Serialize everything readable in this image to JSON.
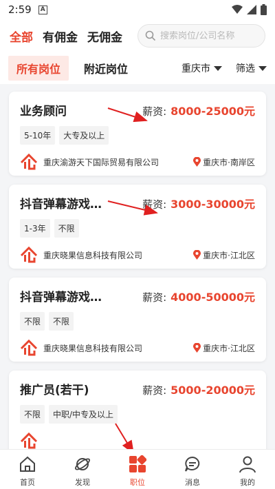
{
  "status_bar": {
    "time": "2:59"
  },
  "filter_tabs": [
    {
      "label": "全部",
      "active": true
    },
    {
      "label": "有佣金",
      "active": false
    },
    {
      "label": "无佣金",
      "active": false
    }
  ],
  "search": {
    "placeholder": "搜索岗位/公司名称"
  },
  "position_tabs": [
    {
      "label": "所有岗位",
      "active": true
    },
    {
      "label": "附近岗位",
      "active": false
    }
  ],
  "city_dropdown": "重庆市",
  "filter_dropdown": "筛选",
  "salary_label": "薪资:",
  "jobs": [
    {
      "title": "业务顾问",
      "salary": "8000-25000元",
      "tags": [
        "5-10年",
        "大专及以上"
      ],
      "company": "重庆渝游天下国际贸易有限公司",
      "location": "重庆市·南岸区"
    },
    {
      "title": "抖音弹幕游戏…",
      "salary": "3000-30000元",
      "tags": [
        "1-3年",
        "不限"
      ],
      "company": "重庆晓果信息科技有限公司",
      "location": "重庆市·江北区"
    },
    {
      "title": "抖音弹幕游戏…",
      "salary": "4000-50000元",
      "tags": [
        "不限",
        "不限"
      ],
      "company": "重庆晓果信息科技有限公司",
      "location": "重庆市·江北区"
    },
    {
      "title": "推广员(若干)",
      "salary": "5000-20000元",
      "tags": [
        "不限",
        "中职/中专及以上"
      ],
      "company": "",
      "location": ""
    }
  ],
  "bottom_nav": [
    {
      "label": "首页",
      "icon": "home-icon",
      "active": false
    },
    {
      "label": "发现",
      "icon": "planet-icon",
      "active": false
    },
    {
      "label": "职位",
      "icon": "grid-icon",
      "active": true
    },
    {
      "label": "消息",
      "icon": "chat-icon",
      "active": false
    },
    {
      "label": "我的",
      "icon": "person-icon",
      "active": false
    }
  ],
  "colors": {
    "accent": "#e8452f",
    "tab_bg": "#fde9e5",
    "background": "#f4f5f7"
  }
}
